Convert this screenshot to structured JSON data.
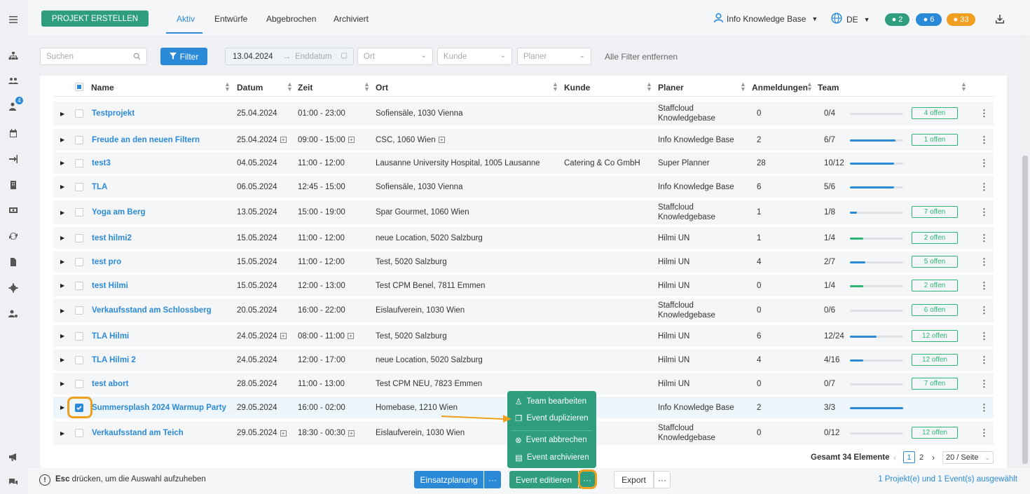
{
  "header": {
    "create_label": "PROJEKT ERSTELLEN",
    "tabs": [
      "Aktiv",
      "Entwürfe",
      "Abgebrochen",
      "Archiviert"
    ],
    "user": "Info Knowledge Base",
    "lang": "DE",
    "badge_messages": "2",
    "badge_notifications": "6",
    "badge_warnings": "33"
  },
  "filters": {
    "search_placeholder": "Suchen",
    "filter_label": "Filter",
    "date_start": "13.04.2024",
    "date_end": "Enddatum",
    "ort": "Ort",
    "kunde": "Kunde",
    "planer": "Planer",
    "clear_label": "Alle Filter entfernen"
  },
  "table": {
    "headers": [
      "Name",
      "Datum",
      "Zeit",
      "Ort",
      "Kunde",
      "Planer",
      "Anmeldungen",
      "Team"
    ],
    "rows": [
      {
        "name": "Testprojekt",
        "date": "25.04.2024",
        "time": "01:00 - 23:00",
        "ort": "Sofiensäle, 1030 Vienna",
        "kunde": "",
        "planer": "Staffcloud Knowledgebase",
        "anmeldungen": "0",
        "team": "0/4",
        "fill": 0.0,
        "offen": "4 offen"
      },
      {
        "name": "Freude an den neuen Filtern",
        "date": "25.04.2024",
        "time": "09:00 - 15:00",
        "ort": "CSC, 1060 Wien",
        "kunde": "",
        "planer": "Info Knowledge Base",
        "anmeldungen": "2",
        "team": "6/7",
        "fill": 0.86,
        "offen": "1 offen"
      },
      {
        "name": "test3",
        "date": "04.05.2024",
        "time": "11:00 - 12:00",
        "ort": "Lausanne University Hospital, 1005 Lausanne",
        "kunde": "Catering & Co GmbH",
        "planer": "Super Planner",
        "anmeldungen": "28",
        "team": "10/12",
        "fill": 0.83,
        "offen": ""
      },
      {
        "name": "TLA",
        "date": "06.05.2024",
        "time": "12:45 - 15:00",
        "ort": "Sofiensäle, 1030 Vienna",
        "kunde": "",
        "planer": "Info Knowledge Base",
        "anmeldungen": "6",
        "team": "5/6",
        "fill": 0.83,
        "offen": ""
      },
      {
        "name": "Yoga am Berg",
        "date": "13.05.2024",
        "time": "15:00 - 19:00",
        "ort": "Spar Gourmet, 1060 Wien",
        "kunde": "",
        "planer": "Staffcloud Knowledgebase",
        "anmeldungen": "1",
        "team": "1/8",
        "fill": 0.125,
        "offen": "7 offen"
      },
      {
        "name": "test hilmi2",
        "date": "15.05.2024",
        "time": "11:00 - 12:00",
        "ort": "neue Location, 5020 Salzburg",
        "kunde": "",
        "planer": "Hilmi UN",
        "anmeldungen": "1",
        "team": "1/4",
        "fill": 0.25,
        "offen": "2 offen"
      },
      {
        "name": "test pro",
        "date": "15.05.2024",
        "time": "11:00 - 12:00",
        "ort": "Test, 5020 Salzburg",
        "kunde": "",
        "planer": "Hilmi UN",
        "anmeldungen": "4",
        "team": "2/7",
        "fill": 0.29,
        "offen": "5 offen"
      },
      {
        "name": "test Hilmi",
        "date": "15.05.2024",
        "time": "12:00 - 13:00",
        "ort": "Test CPM Benel, 7811 Emmen",
        "kunde": "",
        "planer": "Hilmi UN",
        "anmeldungen": "0",
        "team": "1/4",
        "fill": 0.25,
        "offen": "2 offen"
      },
      {
        "name": "Verkaufsstand am Schlossberg",
        "date": "20.05.2024",
        "time": "16:00 - 22:00",
        "ort": "Eislaufverein, 1030 Wien",
        "kunde": "",
        "planer": "Staffcloud Knowledgebase",
        "anmeldungen": "0",
        "team": "0/6",
        "fill": 0.0,
        "offen": "6 offen"
      },
      {
        "name": "TLA Hilmi",
        "date": "24.05.2024",
        "time": "08:00 - 11:00",
        "ort": "Test, 5020 Salzburg",
        "kunde": "",
        "planer": "Hilmi UN",
        "anmeldungen": "6",
        "team": "12/24",
        "fill": 0.5,
        "offen": "12 offen"
      },
      {
        "name": "TLA Hilmi 2",
        "date": "24.05.2024",
        "time": "12:00 - 17:00",
        "ort": "neue Location, 5020 Salzburg",
        "kunde": "",
        "planer": "Hilmi UN",
        "anmeldungen": "4",
        "team": "4/16",
        "fill": 0.25,
        "offen": "12 offen"
      },
      {
        "name": "test abort",
        "date": "28.05.2024",
        "time": "11:00 - 13:00",
        "ort": "Test CPM NEU, 7823 Emmen",
        "kunde": "",
        "planer": "Hilmi UN",
        "anmeldungen": "0",
        "team": "0/7",
        "fill": 0.0,
        "offen": "7 offen"
      },
      {
        "name": "Summersplash 2024 Warmup Party",
        "date": "29.05.2024",
        "time": "16:00 - 02:00",
        "ort": "Homebase, 1210 Wien",
        "kunde": "",
        "planer": "Info Knowledge Base",
        "anmeldungen": "2",
        "team": "3/3",
        "fill": 1.0,
        "offen": ""
      },
      {
        "name": "Verkaufsstand am Teich",
        "date": "29.05.2024",
        "time": "18:30 - 00:30",
        "ort": "Eislaufverein, 1030 Wien",
        "kunde": "",
        "planer": "Staffcloud Knowledgebase",
        "anmeldungen": "0",
        "team": "0/12",
        "fill": 0.0,
        "offen": "12 offen"
      }
    ]
  },
  "pagination": {
    "total": "Gesamt 34 Elemente",
    "page1": "1",
    "page2": "2",
    "per_page": "20 / Seite"
  },
  "context_menu": {
    "items": [
      "Team bearbeiten",
      "Event duplizieren",
      "Event abbrechen",
      "Event archivieren"
    ]
  },
  "footer": {
    "esc_key": "Esc",
    "esc_text": "drücken, um die Auswahl aufzuheben",
    "einsatzplanung": "Einsatzplanung",
    "event_edit": "Event editieren",
    "export": "Export",
    "more": "···",
    "selection": "1 Projekt(e) und 1 Event(s) ausgewählt"
  }
}
